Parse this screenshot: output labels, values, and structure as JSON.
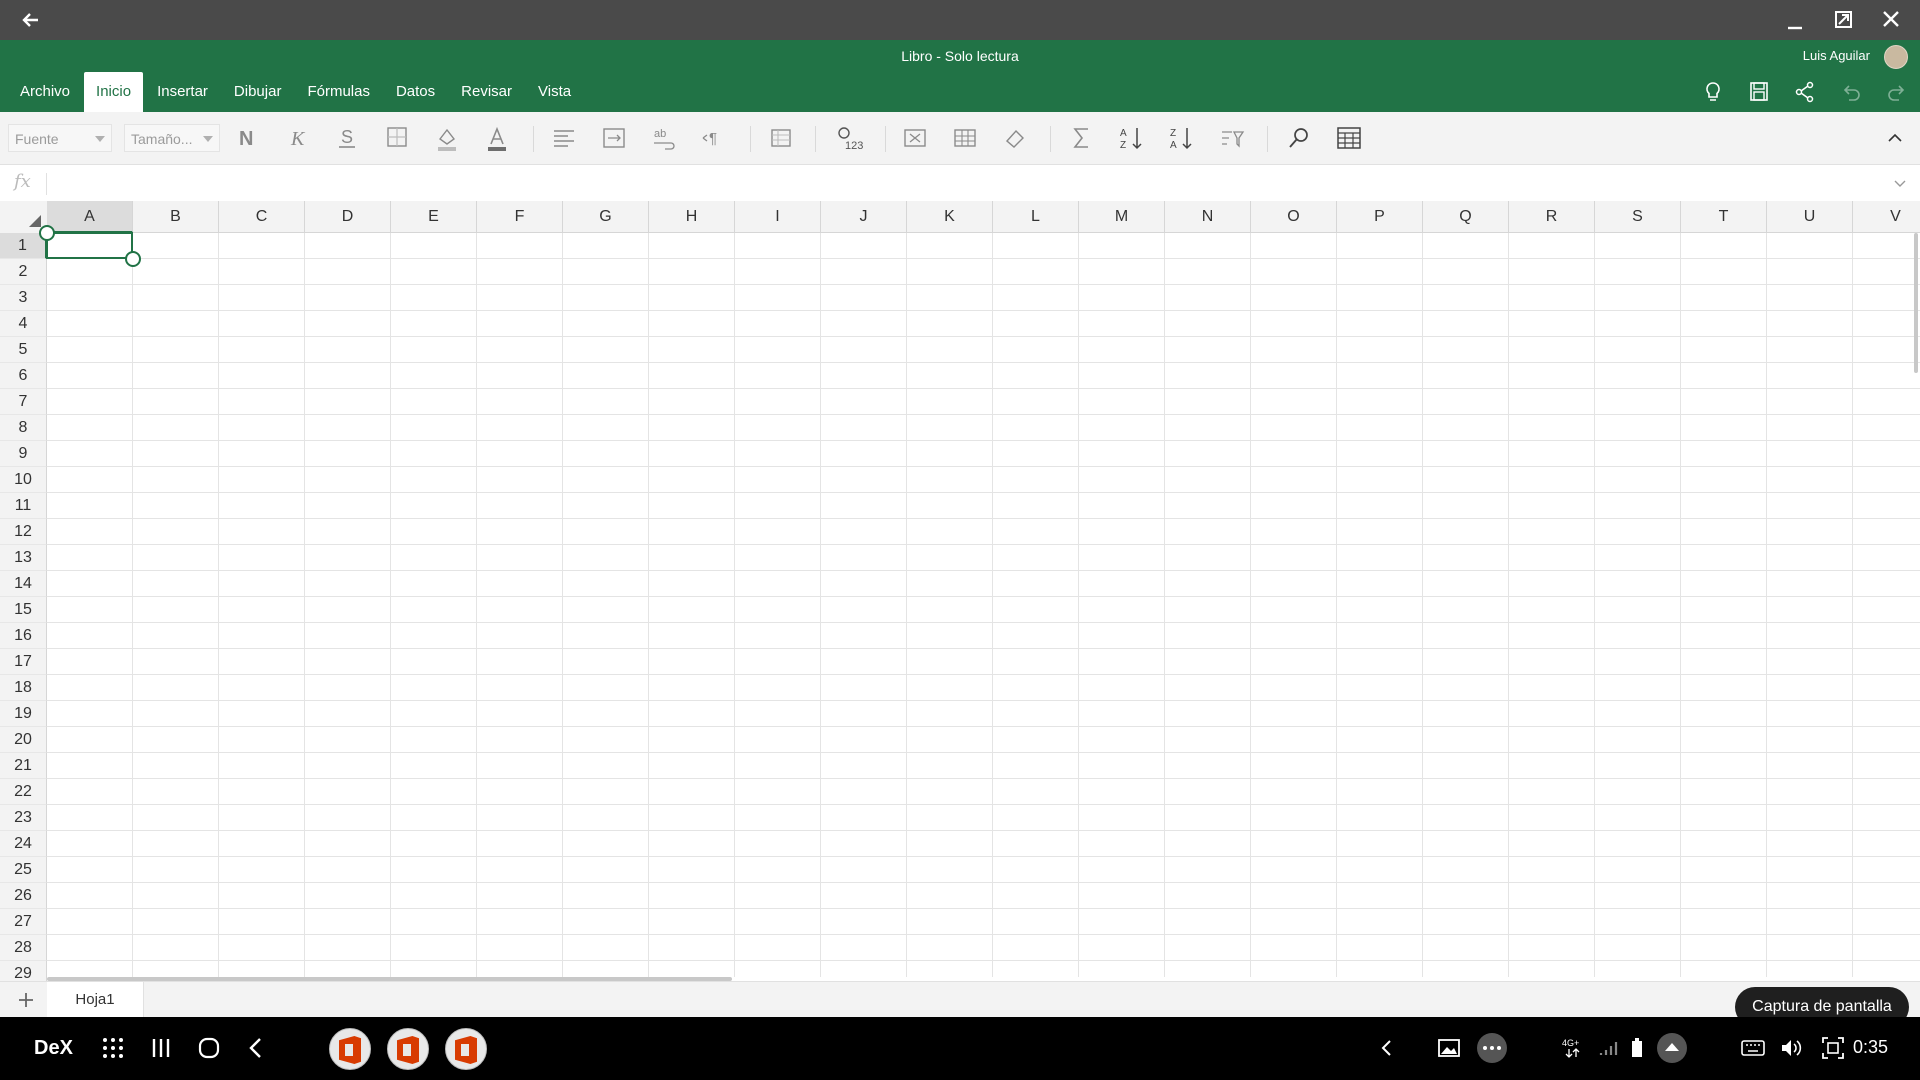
{
  "window": {
    "title": "Libro - Solo lectura",
    "user": "Luis Aguilar"
  },
  "tabs": [
    "Archivo",
    "Inicio",
    "Insertar",
    "Dibujar",
    "Fórmulas",
    "Datos",
    "Revisar",
    "Vista"
  ],
  "active_tab": "Inicio",
  "ribbon": {
    "font_placeholder": "Fuente",
    "size_placeholder": "Tamaño..."
  },
  "formula_bar": {
    "fx_label": "fx",
    "value": ""
  },
  "columns": [
    "A",
    "B",
    "C",
    "D",
    "E",
    "F",
    "G",
    "H",
    "I",
    "J",
    "K",
    "L",
    "M",
    "N",
    "O",
    "P",
    "Q",
    "R",
    "S",
    "T",
    "U",
    "V"
  ],
  "rows": [
    "1",
    "2",
    "3",
    "4",
    "5",
    "6",
    "7",
    "8",
    "9",
    "10",
    "11",
    "12",
    "13",
    "14",
    "15",
    "16",
    "17",
    "18",
    "19",
    "20",
    "21",
    "22",
    "23",
    "24",
    "25",
    "26",
    "27",
    "28",
    "29"
  ],
  "selected_cell": "A1",
  "sheets": [
    "Hoja1"
  ],
  "taskbar": {
    "dex_label": "DeX",
    "time": "0:35",
    "tooltip": "Captura de pantalla"
  },
  "colors": {
    "excel_green": "#217346",
    "topbar": "#4a4a4a",
    "office_red": "#d83b01"
  }
}
